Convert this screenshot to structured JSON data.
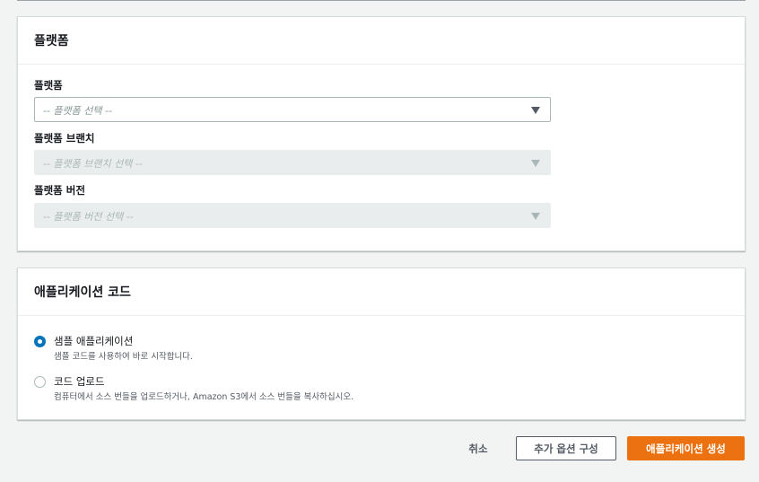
{
  "platform_section": {
    "title": "플랫폼",
    "platform": {
      "label": "플랫폼",
      "placeholder": "-- 플랫폼 선택 --"
    },
    "branch": {
      "label": "플랫폼 브랜치",
      "placeholder": "-- 플랫폼 브랜치 선택 --"
    },
    "version": {
      "label": "플랫폼 버전",
      "placeholder": "-- 플랫폼 버전 선택 --"
    }
  },
  "code_section": {
    "title": "애플리케이션 코드",
    "options": [
      {
        "label": "샘플 애플리케이션",
        "description": "샘플 코드를 사용하여 바로 시작합니다.",
        "selected": true
      },
      {
        "label": "코드 업로드",
        "description": "컴퓨터에서 소스 번들을 업로드하거나, Amazon S3에서 소스 번들을 복사하십시오.",
        "selected": false
      }
    ]
  },
  "footer": {
    "cancel_label": "취소",
    "more_options_label": "추가 옵션 구성",
    "create_label": "애플리케이션 생성"
  },
  "colors": {
    "accent": "#ec7211",
    "radio_selected": "#0073bb"
  },
  "icons": [
    "caret-down-icon"
  ]
}
